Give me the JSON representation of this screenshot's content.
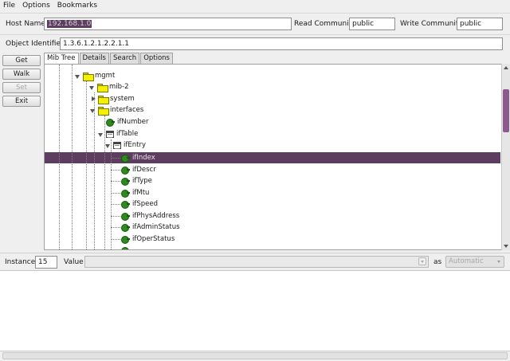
{
  "menu": {
    "file": "File",
    "options": "Options",
    "bookmarks": "Bookmarks"
  },
  "host": {
    "host_label": "Host Name",
    "host_value": "192.168.1.0",
    "read_label": "Read Community",
    "read_value": "public",
    "write_label": "Write Community",
    "write_value": "public"
  },
  "oid": {
    "label": "Object Identifier",
    "value": "1.3.6.1.2.1.2.2.1.1"
  },
  "buttons": {
    "get": "Get",
    "walk": "Walk",
    "set": "Set",
    "exit": "Exit"
  },
  "tabs": {
    "mib_tree": "Mib Tree",
    "details": "Details",
    "search": "Search",
    "options": "Options"
  },
  "tree": {
    "mgmt": "mgmt",
    "mib2": "mib-2",
    "system": "system",
    "interfaces": "interfaces",
    "ifNumber": "ifNumber",
    "ifTable": "ifTable",
    "ifEntry": "ifEntry",
    "ifIndex": "ifIndex",
    "ifDescr": "ifDescr",
    "ifType": "ifType",
    "ifMtu": "ifMtu",
    "ifSpeed": "ifSpeed",
    "ifPhysAddress": "ifPhysAddress",
    "ifAdminStatus": "ifAdminStatus",
    "ifOperStatus": "ifOperStatus"
  },
  "bottom": {
    "instance_label": "Instance",
    "instance_value": "15",
    "value_label": "Value",
    "as_label": "as",
    "as_value": "Automatic"
  },
  "colors": {
    "selection": "#5d3e60",
    "scroll_thumb": "#8d5a90",
    "leaf": "#2e8a1e",
    "folder": "#f4f000"
  }
}
